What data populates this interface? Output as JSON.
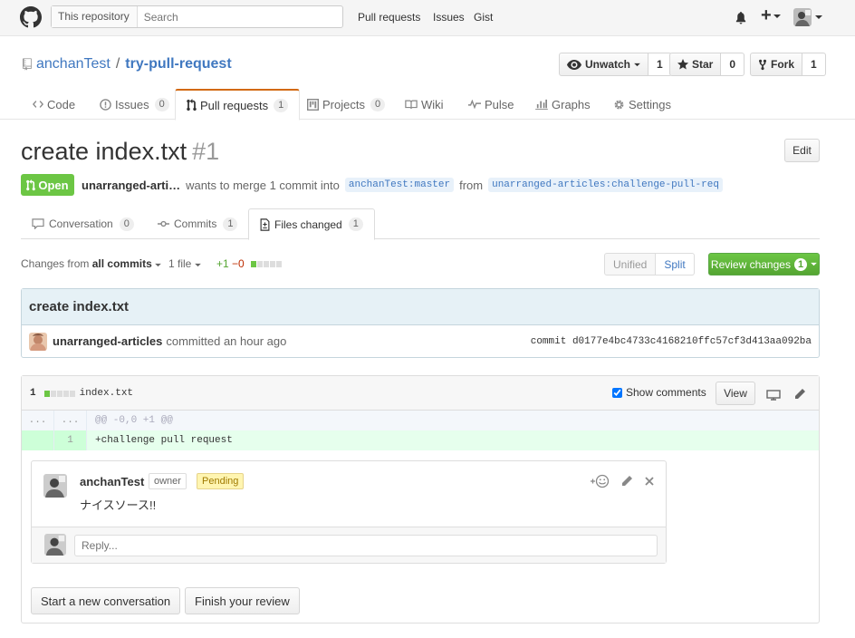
{
  "header": {
    "search_scope": "This repository",
    "search_placeholder": "Search",
    "nav": [
      "Pull requests",
      "Issues",
      "Gist"
    ],
    "plus_label": "+"
  },
  "repo": {
    "owner": "anchanTest",
    "separator": "/",
    "name": "try-pull-request",
    "watch_label": "Unwatch",
    "watch_count": "1",
    "star_label": "Star",
    "star_count": "0",
    "fork_label": "Fork",
    "fork_count": "1"
  },
  "repo_tabs": [
    {
      "label": "Code"
    },
    {
      "label": "Issues",
      "count": "0"
    },
    {
      "label": "Pull requests",
      "count": "1"
    },
    {
      "label": "Projects",
      "count": "0"
    },
    {
      "label": "Wiki"
    },
    {
      "label": "Pulse"
    },
    {
      "label": "Graphs"
    },
    {
      "label": "Settings"
    }
  ],
  "pr": {
    "title": "create index.txt",
    "number": "#1",
    "edit_label": "Edit",
    "state": "Open",
    "author": "unarranged-arti…",
    "merge_text": "wants to merge 1 commit into",
    "base_ref": "anchanTest:master",
    "from_text": "from",
    "head_ref": "unarranged-articles:challenge-pull-req"
  },
  "pr_tabs": [
    {
      "label": "Conversation",
      "count": "0"
    },
    {
      "label": "Commits",
      "count": "1"
    },
    {
      "label": "Files changed",
      "count": "1"
    }
  ],
  "toolbar": {
    "changes_from": "Changes from",
    "all_commits": "all commits",
    "file_count": "1 file",
    "additions": "+1",
    "deletions": "−0",
    "unified": "Unified",
    "split": "Split",
    "review_label": "Review changes",
    "review_count": "1"
  },
  "commit": {
    "title": "create index.txt",
    "author": "unarranged-articles",
    "action": "committed an hour ago",
    "sha_label": "commit",
    "sha": "d0177e4bc4733c4168210ffc57cf3d413aa092ba"
  },
  "file": {
    "changes": "1",
    "name": "index.txt",
    "show_comments": "Show comments",
    "view_label": "View",
    "hunk_left": "...",
    "hunk_right": "...",
    "hunk_header": "@@ -0,0 +1 @@",
    "line_number": "1",
    "line_code": "+challenge pull request"
  },
  "comment": {
    "author": "anchanTest",
    "role": "owner",
    "status": "Pending",
    "body": "ナイスソース!!",
    "reply_placeholder": "Reply..."
  },
  "actions": {
    "new_conversation": "Start a new conversation",
    "finish_review": "Finish your review"
  }
}
